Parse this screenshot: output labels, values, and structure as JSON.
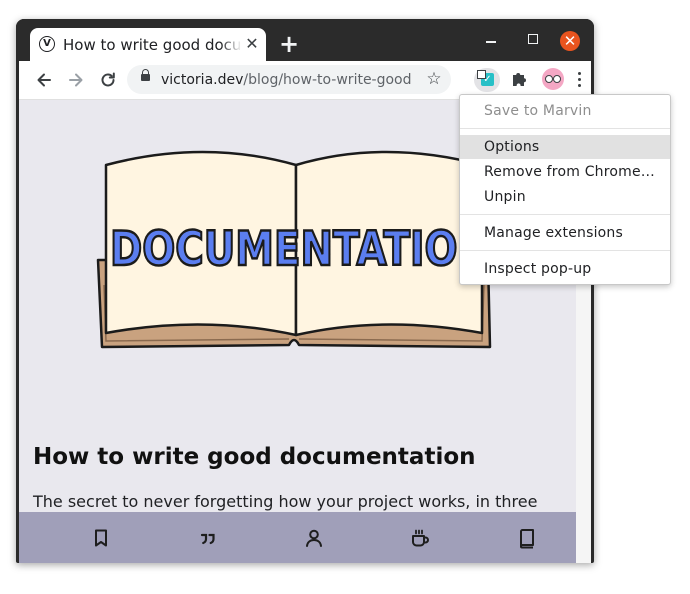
{
  "browser": {
    "tab": {
      "title": "How to write good documentation",
      "favicon_letter": "V",
      "close_glyph": "✕"
    },
    "new_tab_glyph": "+",
    "window_controls": {
      "close_glyph": "✕"
    },
    "url": {
      "host": "victoria.dev",
      "path": "/blog/how-to-write-good-..."
    }
  },
  "page": {
    "hero_text": "DOCUMENTATION",
    "heading": "How to write good documentation",
    "subtitle": "The secret to never forgetting how your project works, in three steps."
  },
  "context_menu": {
    "items": [
      {
        "label": "Save to Marvin",
        "enabled": false
      },
      {
        "label": "Options",
        "enabled": true,
        "highlighted": true
      },
      {
        "label": "Remove from Chrome…",
        "enabled": true
      },
      {
        "label": "Unpin",
        "enabled": true
      },
      {
        "label": "Manage extensions",
        "enabled": true
      },
      {
        "label": "Inspect pop-up",
        "enabled": true
      }
    ]
  },
  "icons": {
    "toolbar": [
      "back-icon",
      "forward-icon",
      "reload-icon",
      "lock-icon",
      "star-icon",
      "marvin-extension-icon",
      "extensions-puzzle-icon",
      "profile-avatar-icon",
      "kebab-menu-icon"
    ],
    "bottom_nav": [
      "bookmark-icon",
      "quote-icon",
      "person-icon",
      "coffee-icon",
      "book-icon"
    ]
  },
  "colors": {
    "chrome_frame": "#2b2b2b",
    "close_button": "#e9541f",
    "page_background": "#e9e8ee",
    "bottom_nav": "#a09fb9",
    "hero_letters": "#5b7ef0",
    "book_pages": "#fff5e1",
    "book_cover": "#c9a27f",
    "marvin_accent": "#27c0c7",
    "menu_highlight": "#e1e1e1"
  }
}
